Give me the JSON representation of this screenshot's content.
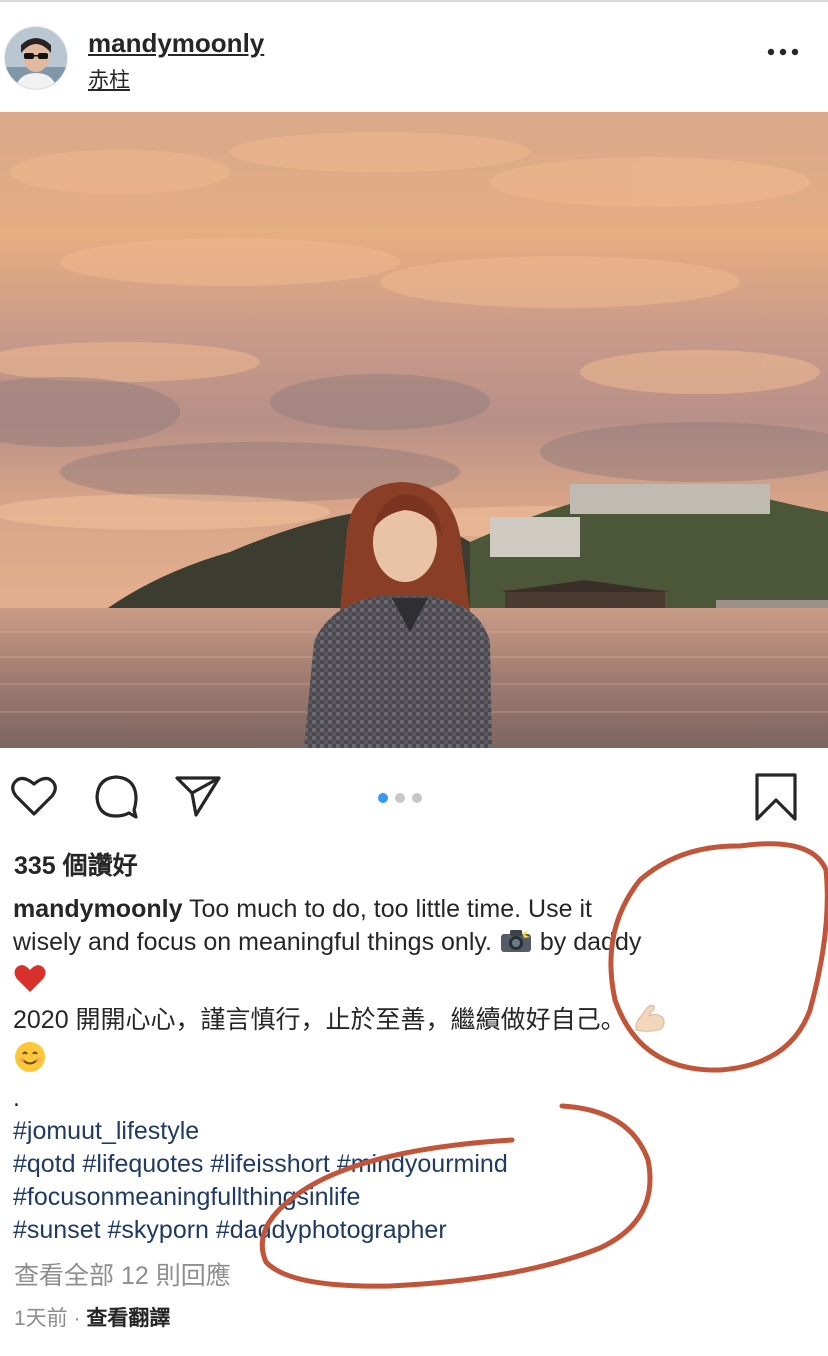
{
  "post": {
    "username": "mandymoonly",
    "location": "赤柱",
    "more_icon": "more-horizontal-icon"
  },
  "carousel": {
    "current": 1,
    "total": 3,
    "active_color": "#3897f0",
    "inactive_color": "#c7c7c7"
  },
  "actions": {
    "like_icon": "heart-outline-icon",
    "comment_icon": "comment-bubble-icon",
    "share_icon": "paper-plane-icon",
    "save_icon": "bookmark-outline-icon"
  },
  "likes_text": "335 個讚好",
  "caption": {
    "username": "mandymoonly",
    "line1": "Too much to do, too little time. Use it",
    "line2a": "wisely and focus on meaningful things only. ",
    "line2b": " by daddy",
    "line4": "2020 開開心心，謹言慎行，止於至善，繼續做好自己。",
    "dot_line": ".",
    "tags1": "#jomuut_lifestyle",
    "tags2": "#qotd #lifequotes #lifeisshort #mindyourmind",
    "tags3": "#focusonmeaningfullthingsinlife",
    "tags4": "#sunset #skyporn #daddyphotographer",
    "emojis": [
      "camera-flash-emoji",
      "red-heart-emoji",
      "flexed-biceps-emoji",
      "smiling-face-emoji"
    ]
  },
  "comments_link": "查看全部 12 則回應",
  "meta": {
    "time": "1天前",
    "separator": " · ",
    "translate": "查看翻譯"
  },
  "annotation_color": "#c0553a"
}
